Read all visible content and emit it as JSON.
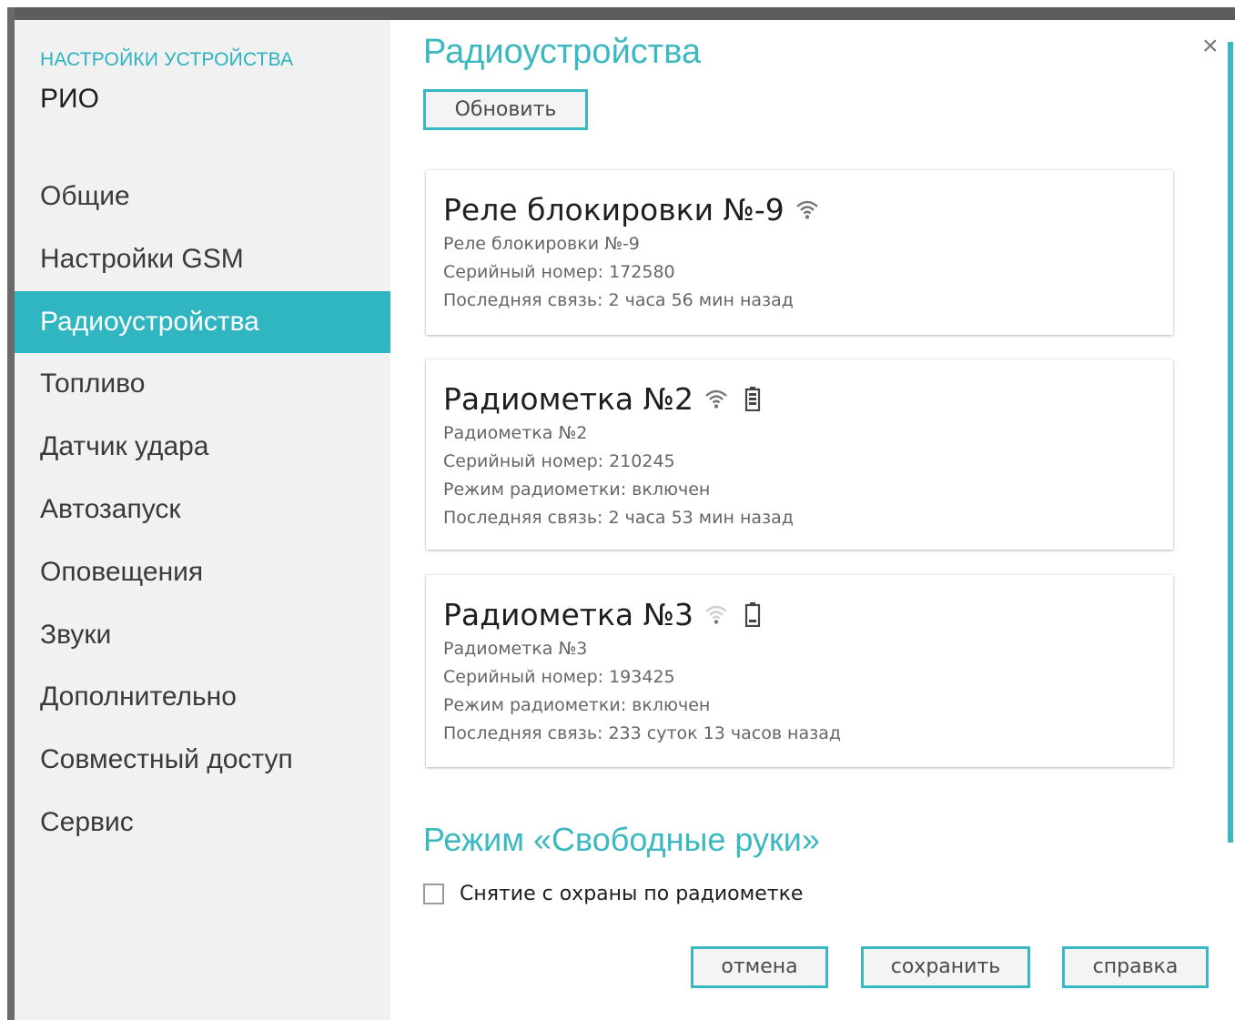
{
  "sidebar": {
    "caption": "НАСТРОЙКИ УСТРОЙСТВА",
    "device_name": "РИО",
    "items": [
      {
        "label": "Общие",
        "active": false
      },
      {
        "label": "Настройки GSM",
        "active": false
      },
      {
        "label": "Радиоустройства",
        "active": true
      },
      {
        "label": "Топливо",
        "active": false
      },
      {
        "label": "Датчик удара",
        "active": false
      },
      {
        "label": "Автозапуск",
        "active": false
      },
      {
        "label": "Оповещения",
        "active": false
      },
      {
        "label": "Звуки",
        "active": false
      },
      {
        "label": "Дополнительно",
        "active": false
      },
      {
        "label": "Совместный доступ",
        "active": false
      },
      {
        "label": "Сервис",
        "active": false
      }
    ]
  },
  "main": {
    "title": "Радиоустройства",
    "refresh_label": "Обновить",
    "devices": [
      {
        "title": "Реле блокировки №-9",
        "signal_icon": "wifi-signal-icon",
        "signal_level": "full",
        "battery_icon": null,
        "lines": [
          "Реле блокировки №-9",
          "Серийный номер: 172580",
          "Последняя связь: 2 часа 56 мин назад"
        ]
      },
      {
        "title": "Радиометка №2",
        "signal_icon": "wifi-signal-icon",
        "signal_level": "full",
        "battery_icon": "battery-icon",
        "battery_level": "full",
        "lines": [
          "Радиометка №2",
          "Серийный номер: 210245",
          "Режим радиометки: включен",
          "Последняя связь: 2 часа 53 мин назад"
        ]
      },
      {
        "title": "Радиометка №3",
        "signal_icon": "wifi-signal-icon",
        "signal_level": "weak",
        "battery_icon": "battery-icon",
        "battery_level": "low",
        "lines": [
          "Радиометка №3",
          "Серийный номер: 193425",
          "Режим радиометки: включен",
          "Последняя связь: 233 суток 13 часов назад"
        ]
      }
    ],
    "hands_free_title": "Режим «Свободные руки»",
    "hands_free_checkbox_label": "Снятие с охраны по радиометке",
    "hands_free_checked": false,
    "buttons": {
      "cancel": "отмена",
      "save": "сохранить",
      "help": "справка"
    },
    "close_icon": "close-icon",
    "close_glyph": "×"
  },
  "colors": {
    "accent": "#2fb6c0",
    "sidebar_bg": "#f1f1f1",
    "text_dark": "#1e1e1e"
  }
}
